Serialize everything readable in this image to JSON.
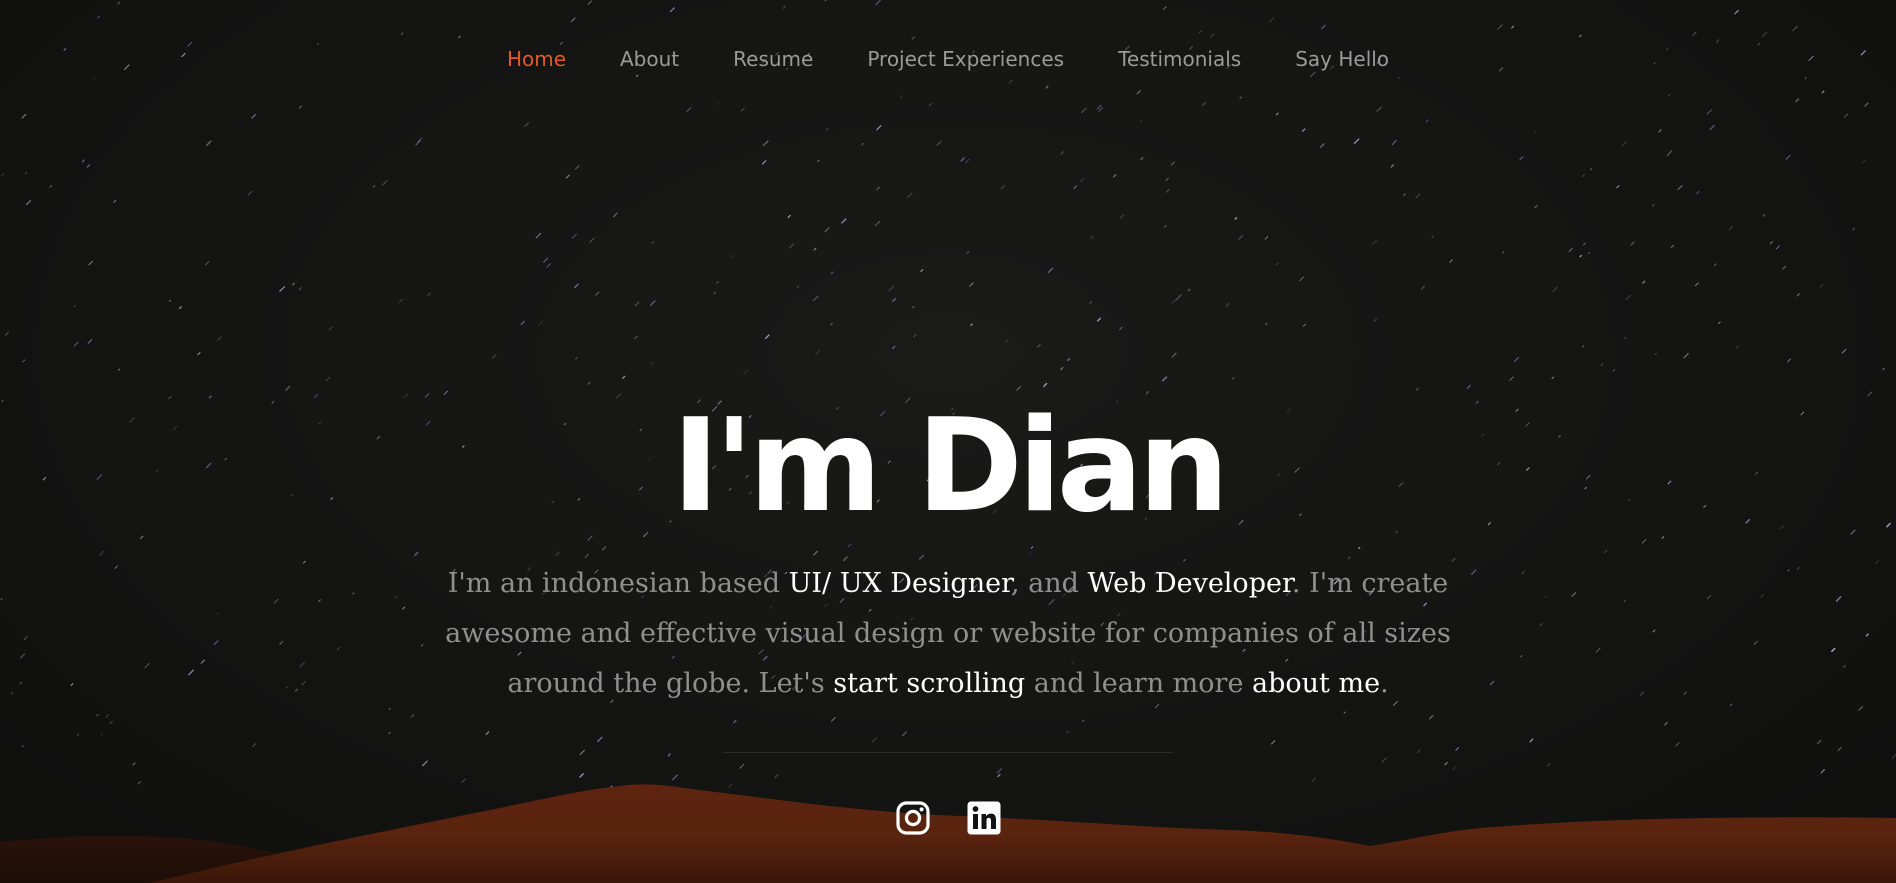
{
  "nav": {
    "items": [
      {
        "label": "Home",
        "active": true
      },
      {
        "label": "About",
        "active": false
      },
      {
        "label": "Resume",
        "active": false
      },
      {
        "label": "Project Experiences",
        "active": false
      },
      {
        "label": "Testimonials",
        "active": false
      },
      {
        "label": "Say Hello",
        "active": false
      }
    ]
  },
  "hero": {
    "title": "I'm Dian",
    "intro": {
      "t1": "I'm an indonesian based ",
      "role1": "UI/ UX Designer",
      "t2": ", and ",
      "role2": "Web Developer",
      "t3": ". I'm create awesome and effective visual design or website for companies of all sizes around the globe. Let's ",
      "link1": "start scrolling",
      "t4": " and learn more ",
      "link2": "about me",
      "t5": "."
    }
  },
  "social": {
    "icons": [
      "instagram-icon",
      "linkedin-icon"
    ]
  },
  "colors": {
    "accent": "#e15a25",
    "background": "#121212",
    "nav_text": "#9a9a9a",
    "body_text": "#8f8f8f",
    "highlight": "#ffffff",
    "dune": "#6a2a12"
  }
}
